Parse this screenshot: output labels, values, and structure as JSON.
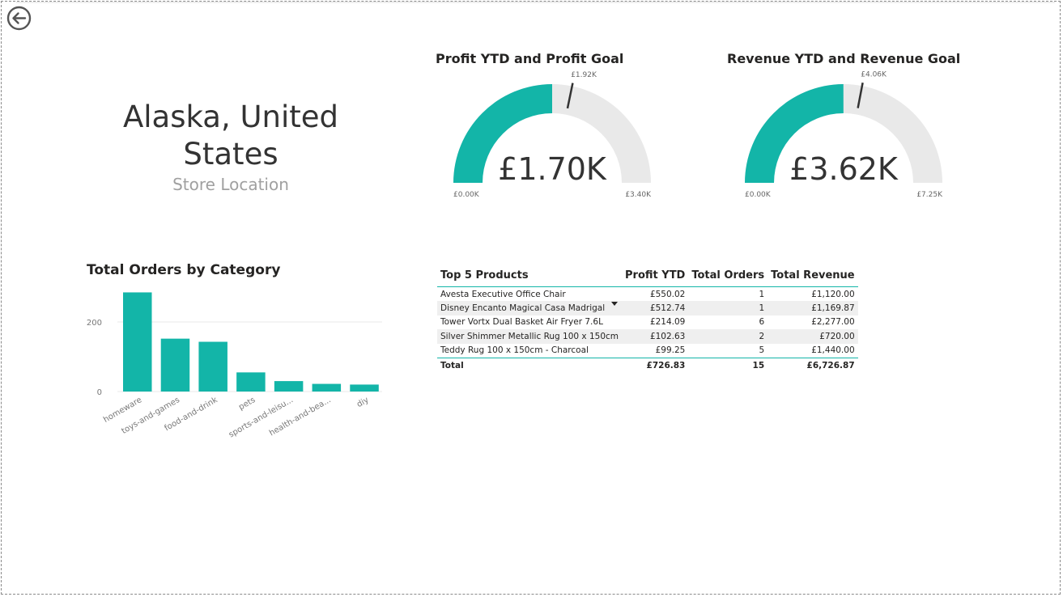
{
  "nav": {
    "back_icon": "back-arrow-icon"
  },
  "location": {
    "name": "Alaska, United States",
    "label": "Store Location"
  },
  "gauges": [
    {
      "title": "Profit YTD and Profit Goal",
      "value": 1700,
      "value_label": "£1.70K",
      "min": 0,
      "min_label": "£0.00K",
      "max": 3400,
      "max_label": "£3.40K",
      "target": 1920,
      "target_label": "£1.92K",
      "color": "#13b5a8",
      "track_color": "#e9e9e9"
    },
    {
      "title": "Revenue YTD and Revenue Goal",
      "value": 3620,
      "value_label": "£3.62K",
      "min": 0,
      "min_label": "£0.00K",
      "max": 7250,
      "max_label": "£7.25K",
      "target": 4060,
      "target_label": "£4.06K",
      "color": "#13b5a8",
      "track_color": "#e9e9e9"
    }
  ],
  "category_chart": {
    "title": "Total Orders by Category",
    "chart_data": {
      "type": "bar",
      "title": "Total Orders by Category",
      "categories": [
        "homeware",
        "toys-and-games",
        "food-and-drink",
        "pets",
        "sports-and-leisu...",
        "health-and-bea...",
        "diy"
      ],
      "values": [
        285,
        152,
        143,
        55,
        30,
        22,
        20
      ],
      "yticks": [
        0,
        200
      ],
      "ylim": [
        0,
        300
      ],
      "grid": true,
      "color": "#13b5a8"
    }
  },
  "products_table": {
    "headers": [
      "Top 5 Products",
      "Profit YTD",
      "Total Orders",
      "Total Revenue"
    ],
    "sorted_column": "Profit YTD",
    "rows": [
      [
        "Avesta Executive Office Chair",
        "£550.02",
        "1",
        "£1,120.00"
      ],
      [
        "Disney Encanto Magical Casa Madrigal",
        "£512.74",
        "1",
        "£1,169.87"
      ],
      [
        "Tower Vortx Dual Basket Air Fryer 7.6L",
        "£214.09",
        "6",
        "£2,277.00"
      ],
      [
        "Silver Shimmer Metallic Rug 100 x 150cm",
        "£102.63",
        "2",
        "£720.00"
      ],
      [
        "Teddy Rug 100 x 150cm - Charcoal",
        "£99.25",
        "5",
        "£1,440.00"
      ]
    ],
    "total": [
      "Total",
      "£726.83",
      "15",
      "£6,726.87"
    ]
  }
}
